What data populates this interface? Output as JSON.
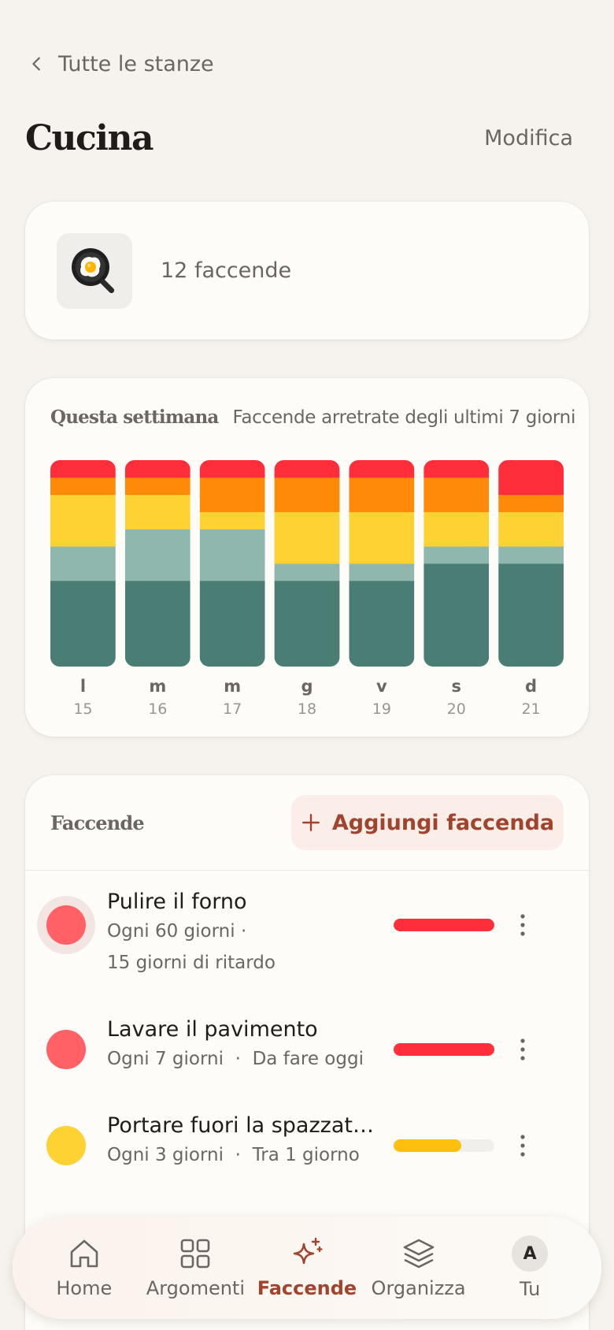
{
  "nav": {
    "back_label": "Tutte le stanze"
  },
  "header": {
    "title": "Cucina",
    "edit_label": "Modifica"
  },
  "room": {
    "emoji": "🍳",
    "summary": "12 faccende"
  },
  "week": {
    "title": "Questa settimana",
    "subtitle": "Faccende arretrate degli ultimi 7 giorni"
  },
  "chart_data": {
    "type": "bar",
    "stacked": true,
    "categories": [
      "l",
      "m",
      "m",
      "g",
      "v",
      "s",
      "d"
    ],
    "dates": [
      "15",
      "16",
      "17",
      "18",
      "19",
      "20",
      "21"
    ],
    "series": [
      {
        "color": "#4a7d73",
        "values": [
          5,
          5,
          5,
          5,
          5,
          6,
          6
        ]
      },
      {
        "color": "#8fb7ae",
        "values": [
          2,
          3,
          3,
          1,
          1,
          1,
          1
        ]
      },
      {
        "color": "#ffd233",
        "values": [
          3,
          2,
          1,
          3,
          3,
          2,
          2
        ]
      },
      {
        "color": "#ff8a0a",
        "values": [
          1,
          1,
          2,
          2,
          2,
          2,
          1
        ]
      },
      {
        "color": "#ff2e3a",
        "values": [
          1,
          1,
          1,
          1,
          1,
          1,
          2
        ]
      }
    ],
    "ylim": [
      0,
      12
    ],
    "grid": false,
    "legend": "none"
  },
  "chores": {
    "title": "Faccende",
    "add_label": "Aggiungi faccenda",
    "items": [
      {
        "name": "Pulire il forno",
        "frequency": "Ogni 60 giorni",
        "separator": "·",
        "status": "15 giorni di ritardo",
        "dot_color": "#ff6166",
        "bar_color": "#ff2e3a",
        "progress": 1.0
      },
      {
        "name": "Lavare il pavimento",
        "frequency": "Ogni 7 giorni",
        "separator": "·",
        "status": "Da fare oggi",
        "dot_color": "#ff6166",
        "bar_color": "#ff2e3a",
        "progress": 1.0
      },
      {
        "name": "Portare fuori la spazzatura",
        "frequency": "Ogni 3 giorni",
        "separator": "·",
        "status": "Tra 1 giorno",
        "dot_color": "#ffd233",
        "bar_color": "#ffbf0f",
        "progress": 0.67
      }
    ]
  },
  "tabs": {
    "home": "Home",
    "topics": "Argomenti",
    "chores": "Faccende",
    "organize": "Organizza",
    "me": "Tu",
    "avatar_initial": "A",
    "active": "chores",
    "active_color": "#a0442e"
  }
}
